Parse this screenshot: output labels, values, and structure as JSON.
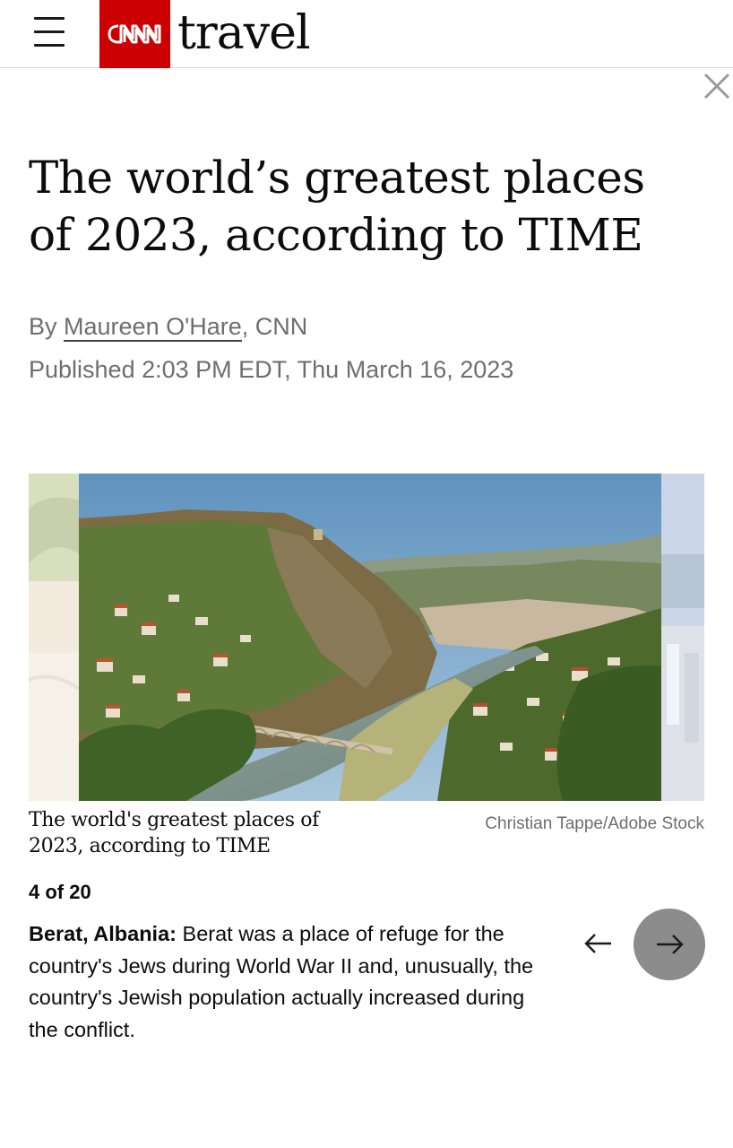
{
  "header": {
    "menu_icon": "hamburger-menu-icon",
    "logo_text": "CNN",
    "section_name": "travel",
    "close_icon": "close-icon"
  },
  "article": {
    "headline": "The world’s greatest places of 2023, according to TIME",
    "byline_prefix": "By ",
    "author": "Maureen O'Hare",
    "byline_suffix": ", CNN",
    "published": "Published 2:03 PM EDT, Thu March 16, 2023"
  },
  "gallery": {
    "caption": "The world's greatest places of 2023, according to TIME",
    "credit": "Christian Tappe/Adobe Stock",
    "counter": "4 of 20",
    "current_index": 4,
    "total": 20,
    "place": "Berat, Albania:",
    "description": " Berat was a place of refuge for the country's Jews during World War II and, unusually, the country's Jewish population actually increased during the conflict.",
    "prev_icon": "arrow-left-icon",
    "next_icon": "arrow-right-icon"
  },
  "colors": {
    "brand_red": "#cc0000",
    "text": "#0c0c0c",
    "muted": "#6e6e6e",
    "next_button": "#8c8c8c"
  }
}
